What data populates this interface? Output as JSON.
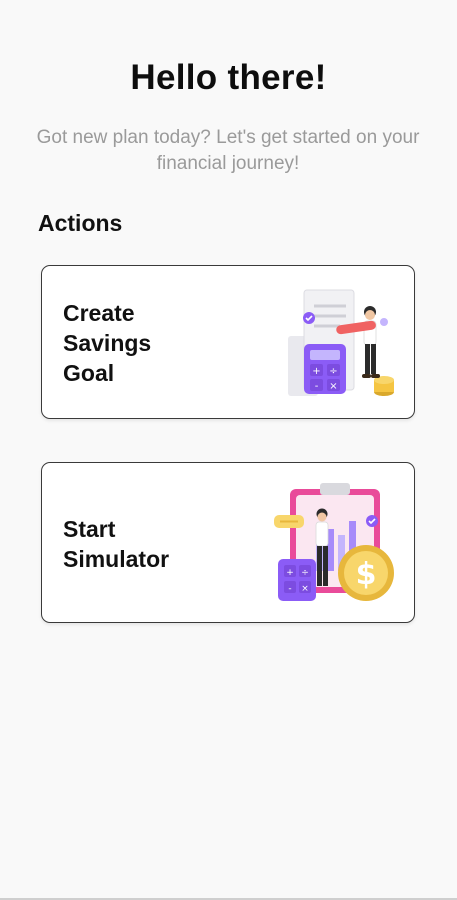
{
  "header": {
    "greeting": "Hello there!",
    "subtitle": "Got new plan today? Let's get started on your financial journey!"
  },
  "actions": {
    "section_title": "Actions",
    "items": [
      {
        "label": "Create\nSavings\nGoal",
        "illustration": "savings-goal-illustration-icon"
      },
      {
        "label": "Start\nSimulator",
        "illustration": "simulator-illustration-icon"
      }
    ]
  },
  "colors": {
    "background": "#f9f9f9",
    "card": "#ffffff",
    "purple": "#8b5cf6",
    "gold": "#f5c542",
    "pink": "#e94b9a",
    "red": "#f06262"
  }
}
